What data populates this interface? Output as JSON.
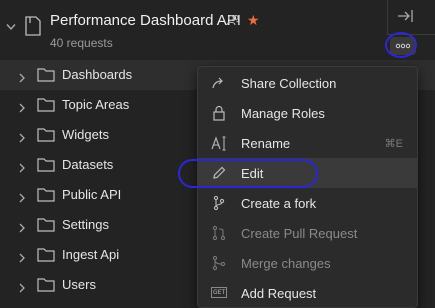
{
  "collection": {
    "title": "Performance Dashboard API",
    "request_count": "40 requests",
    "star_color": "#f26b3a"
  },
  "folders": [
    {
      "label": "Dashboards"
    },
    {
      "label": "Topic Areas"
    },
    {
      "label": "Widgets"
    },
    {
      "label": "Datasets"
    },
    {
      "label": "Public API"
    },
    {
      "label": "Settings"
    },
    {
      "label": "Ingest Api"
    },
    {
      "label": "Users"
    }
  ],
  "menu": {
    "items": [
      {
        "label": "Share Collection",
        "icon": "share-arrow-icon",
        "shortcut": ""
      },
      {
        "label": "Manage Roles",
        "icon": "lock-icon",
        "shortcut": ""
      },
      {
        "label": "Rename",
        "icon": "rename-icon",
        "shortcut": "⌘E"
      },
      {
        "label": "Edit",
        "icon": "pencil-icon",
        "shortcut": ""
      },
      {
        "label": "Create a fork",
        "icon": "fork-icon",
        "shortcut": ""
      },
      {
        "label": "Create Pull Request",
        "icon": "pull-request-icon",
        "shortcut": "",
        "disabled": true
      },
      {
        "label": "Merge changes",
        "icon": "merge-icon",
        "shortcut": "",
        "disabled": true
      },
      {
        "label": "Add Request",
        "icon": "get-request-icon",
        "shortcut": ""
      }
    ],
    "get_badge": "GET"
  },
  "annotation_color": "#2b27d9"
}
